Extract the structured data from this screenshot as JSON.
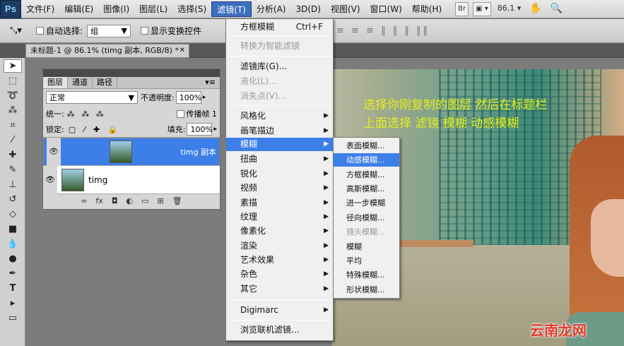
{
  "menubar": {
    "logo": "Ps",
    "items": [
      "文件(F)",
      "编辑(E)",
      "图像(I)",
      "图层(L)",
      "选择(S)",
      "滤镜(T)",
      "分析(A)",
      "3D(D)",
      "视图(V)",
      "窗口(W)",
      "帮助(H)"
    ],
    "active_item": "滤镜(T)",
    "bridge_label": "Br",
    "zoom": "86.1"
  },
  "options": {
    "auto_select_label": "自动选择:",
    "auto_select_value": "组",
    "show_transform_label": "显示变换控件"
  },
  "document": {
    "tab_title": "未标题-1 @ 86.1% (timg 副本, RGB/8) *"
  },
  "filter_menu": {
    "items": [
      {
        "label": "方框模糊",
        "shortcut": "Ctrl+F",
        "state": "normal"
      },
      {
        "label": "转换为智能滤镜",
        "state": "disabled"
      },
      {
        "label": "滤镜库(G)...",
        "state": "normal"
      },
      {
        "label": "液化(L)...",
        "state": "disabled"
      },
      {
        "label": "消失点(V)...",
        "state": "disabled"
      },
      {
        "label": "风格化",
        "submenu": true
      },
      {
        "label": "画笔描边",
        "submenu": true
      },
      {
        "label": "模糊",
        "submenu": true,
        "state": "highlighted"
      },
      {
        "label": "扭曲",
        "submenu": true
      },
      {
        "label": "锐化",
        "submenu": true
      },
      {
        "label": "视频",
        "submenu": true
      },
      {
        "label": "素描",
        "submenu": true
      },
      {
        "label": "纹理",
        "submenu": true
      },
      {
        "label": "像素化",
        "submenu": true
      },
      {
        "label": "渲染",
        "submenu": true
      },
      {
        "label": "艺术效果",
        "submenu": true
      },
      {
        "label": "杂色",
        "submenu": true
      },
      {
        "label": "其它",
        "submenu": true
      },
      {
        "label": "Digimarc",
        "submenu": true
      },
      {
        "label": "浏览联机滤镜..."
      }
    ]
  },
  "blur_submenu": {
    "items": [
      {
        "label": "表面模糊..."
      },
      {
        "label": "动感模糊...",
        "state": "highlighted"
      },
      {
        "label": "方框模糊..."
      },
      {
        "label": "高斯模糊..."
      },
      {
        "label": "进一步模糊"
      },
      {
        "label": "径向模糊..."
      },
      {
        "label": "镜头模糊...",
        "state": "disabled"
      },
      {
        "label": "模糊"
      },
      {
        "label": "平均"
      },
      {
        "label": "特殊模糊..."
      },
      {
        "label": "形状模糊..."
      }
    ]
  },
  "layers_panel": {
    "tabs": [
      "图层",
      "通道",
      "路径"
    ],
    "blend_mode": "正常",
    "opacity_label": "不透明度:",
    "opacity_value": "100%",
    "unify_label": "统一:",
    "propagate_label": "传播帧 1",
    "lock_label": "锁定:",
    "fill_label": "填充:",
    "fill_value": "100%",
    "layers": [
      {
        "name": "timg 副本",
        "selected": true
      },
      {
        "name": "timg",
        "selected": false
      }
    ]
  },
  "instruction": {
    "line1": "选择你刚复制的图层 然后在标题栏",
    "line2": "上面选择 滤镜 模糊 动感模糊"
  },
  "watermark": "云南龙网",
  "colors": {
    "highlight": "#3d7fe8",
    "instruction_text": "#e6ef1a",
    "watermark": "#e23b2a"
  }
}
